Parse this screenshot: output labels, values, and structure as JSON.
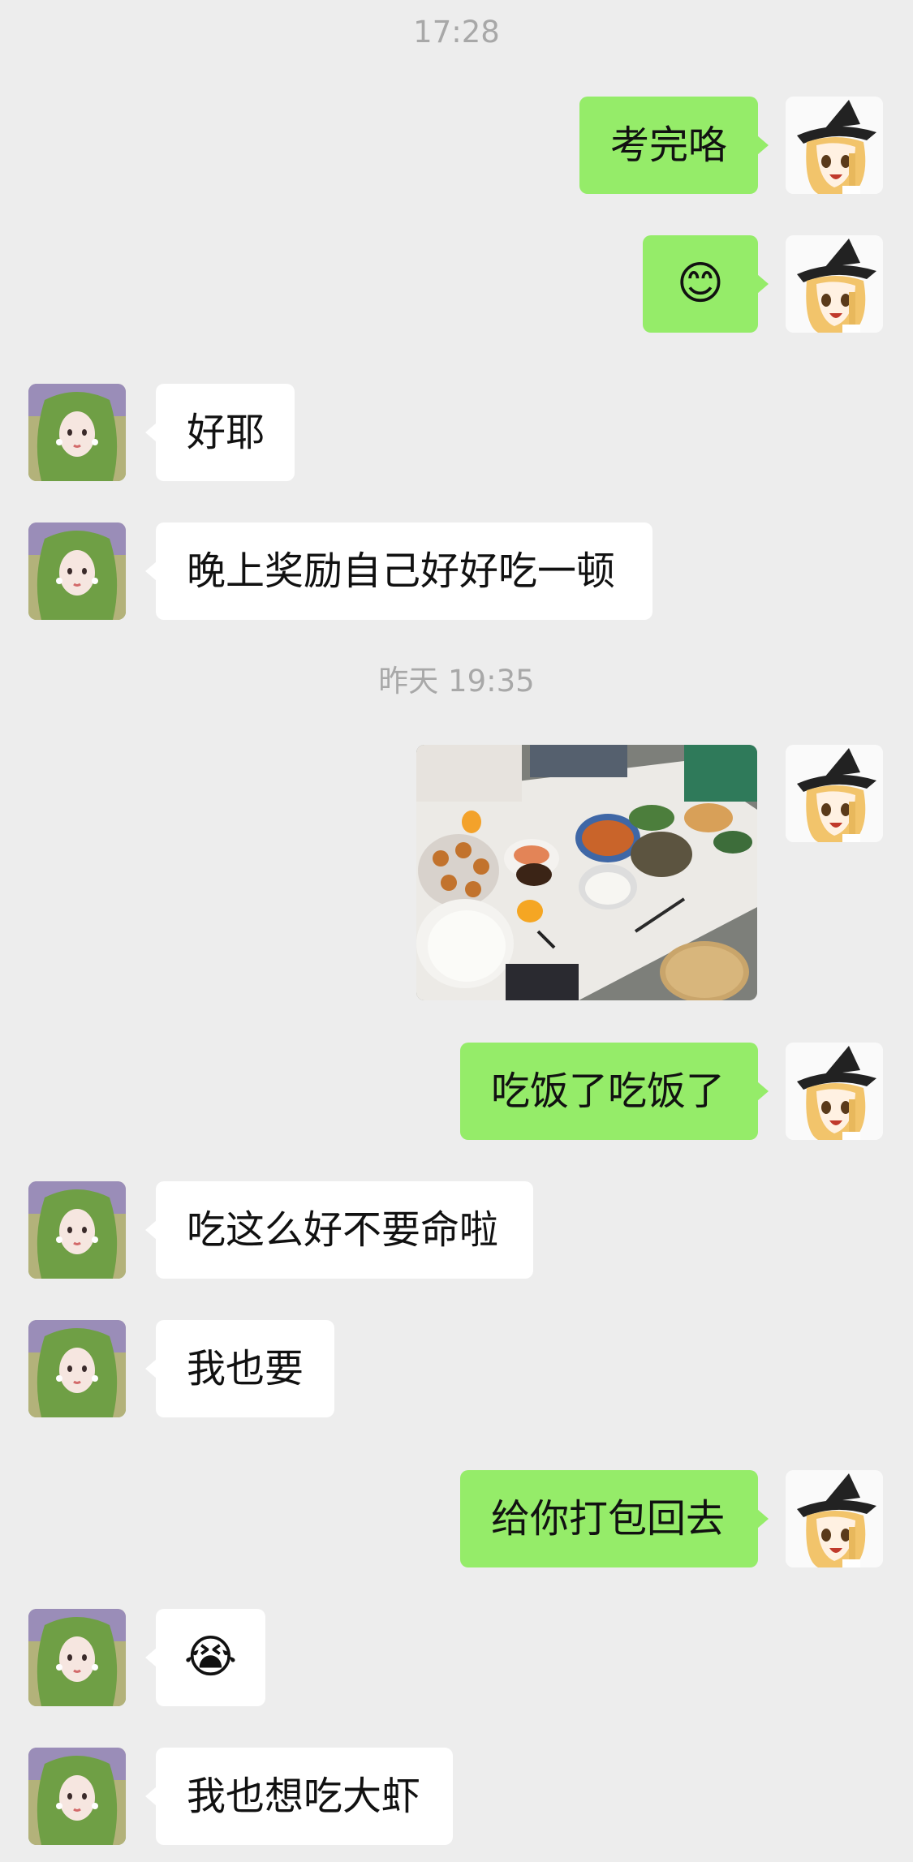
{
  "chat": {
    "timestamps": [
      "17:28",
      "昨天 19:35"
    ],
    "messages": [
      {
        "from": "me",
        "text": "考完咯"
      },
      {
        "from": "me",
        "text": "😊"
      },
      {
        "from": "her",
        "text": "好耶"
      },
      {
        "from": "her",
        "text": "晚上奖励自己好好吃一顿"
      },
      {
        "from": "me",
        "type": "image",
        "subject": "dinner-table-photo"
      },
      {
        "from": "me",
        "text": "吃饭了吃饭了"
      },
      {
        "from": "her",
        "text": "吃这么好不要命啦"
      },
      {
        "from": "her",
        "text": "我也要"
      },
      {
        "from": "me",
        "text": "给你打包回去"
      },
      {
        "from": "her",
        "text": "😭"
      },
      {
        "from": "her",
        "text": "我也想吃大虾"
      }
    ]
  },
  "colors": {
    "background": "#ededed",
    "my_bubble": "#95ec69",
    "her_bubble": "#ffffff",
    "timestamp": "#a8a8a8"
  },
  "icons": {
    "my_avatar": "anime-witch-avatar",
    "her_avatar": "green-hair-girl-avatar"
  }
}
